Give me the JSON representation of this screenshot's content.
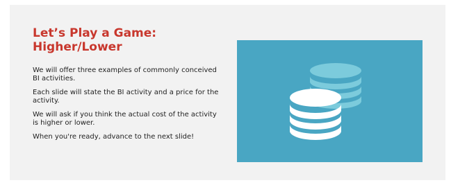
{
  "slide": {
    "title_lines": [
      "Let’s Play a Game:",
      "Higher/Lower"
    ],
    "paragraphs": [
      "We will offer three examples of commonly conceived BI activities.",
      "Each slide will state the BI activity and a price for the activity.",
      "We will ask if you think the actual cost of the activity is higher or lower.",
      "When you're ready, advance to the next slide!"
    ],
    "image": {
      "icon": "coins-icon",
      "background_color": "#49a6c3"
    }
  },
  "colors": {
    "title": "#c8372d",
    "slide_bg": "#f2f2f2",
    "text": "#222222"
  }
}
